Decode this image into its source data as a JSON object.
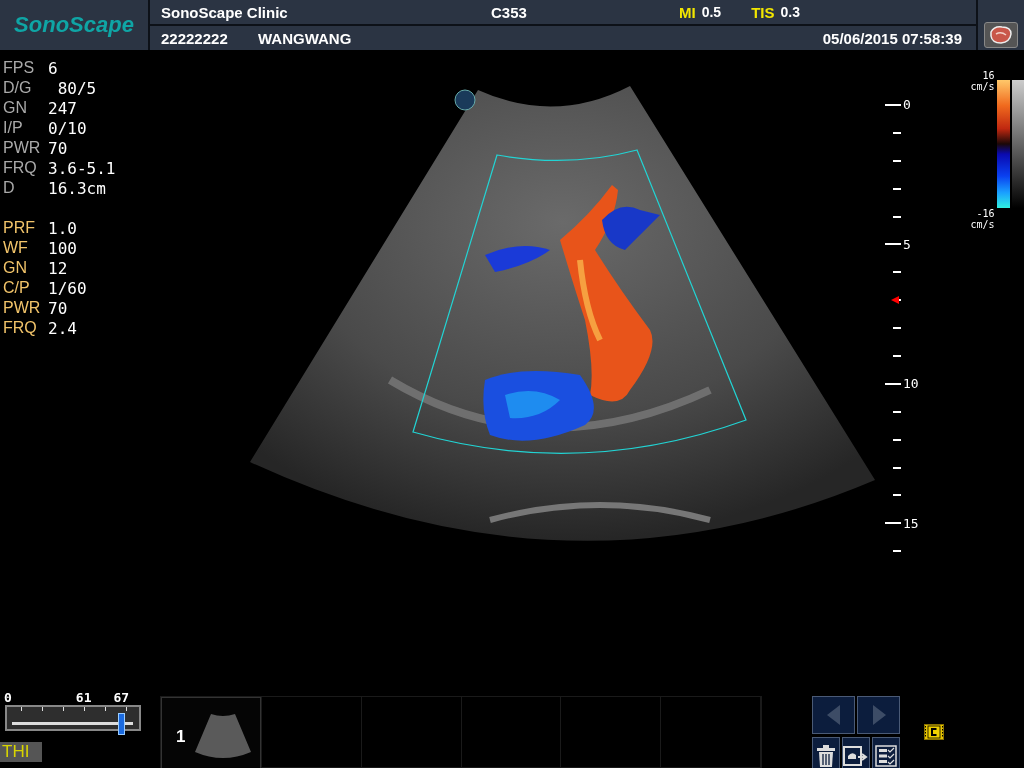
{
  "header": {
    "logo": "SonoScape",
    "clinic": "SonoScape Clinic",
    "probe": "C353",
    "indices": [
      {
        "label": "MI",
        "value": "0.5"
      },
      {
        "label": "TIS",
        "value": "0.3"
      }
    ],
    "patient_id": "22222222",
    "patient_name": "WANGWANG",
    "datetime": "05/06/2015 07:58:39"
  },
  "parameter_groups": [
    {
      "kind": "b-mode",
      "params": [
        {
          "label": "FPS",
          "value": "6"
        },
        {
          "label": "D/G",
          "value": " 80/5"
        },
        {
          "label": "GN",
          "value": "247"
        },
        {
          "label": "I/P",
          "value": "0/10"
        },
        {
          "label": "PWR",
          "value": "70"
        },
        {
          "label": "FRQ",
          "value": "3.6-5.1"
        },
        {
          "label": "D",
          "value": "16.3cm"
        }
      ]
    },
    {
      "kind": "color",
      "params": [
        {
          "label": "PRF",
          "value": "1.0"
        },
        {
          "label": "WF",
          "value": "100"
        },
        {
          "label": "GN",
          "value": "12"
        },
        {
          "label": "C/P",
          "value": "1/60"
        },
        {
          "label": "PWR",
          "value": "70"
        },
        {
          "label": "FRQ",
          "value": "2.4"
        }
      ]
    }
  ],
  "depth_scale": {
    "labels": [
      "0",
      "5",
      "10",
      "15"
    ]
  },
  "color_bar": {
    "max": "16",
    "max_unit": "cm/s",
    "min": "-16",
    "min_unit": "cm/s"
  },
  "slider": {
    "labels": [
      "0",
      "61",
      "67"
    ],
    "level": 0.9
  },
  "mode_label": "THI",
  "thumbnails": [
    {
      "number": "1"
    }
  ],
  "nav_buttons": [
    {
      "kind": "prev"
    },
    {
      "kind": "next"
    }
  ],
  "tool_buttons": [
    {
      "kind": "delete"
    },
    {
      "kind": "export"
    },
    {
      "kind": "report"
    }
  ]
}
